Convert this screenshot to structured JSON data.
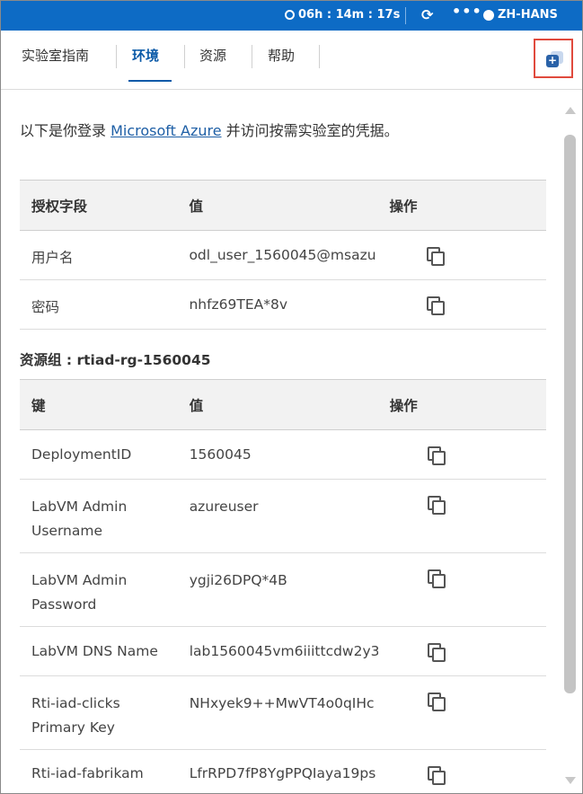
{
  "topbar": {
    "timer": "06h : 14m : 17s",
    "refresh_icon": "refresh-icon",
    "more_label": "•••",
    "language": "ZH-HANS"
  },
  "tabs": [
    {
      "label": "实验室指南",
      "active": false
    },
    {
      "label": "环境",
      "active": true
    },
    {
      "label": "资源",
      "active": false
    },
    {
      "label": "帮助",
      "active": false
    }
  ],
  "intro": {
    "prefix": "以下是你登录 ",
    "link": "Microsoft Azure",
    "suffix": " 并访问按需实验室的凭据。"
  },
  "credentials_table": {
    "headers": [
      "授权字段",
      "值",
      "操作"
    ],
    "rows": [
      {
        "field": "用户名",
        "value": "odl_user_1560045@msazu"
      },
      {
        "field": "密码",
        "value": "nhfz69TEA*8v"
      }
    ]
  },
  "resource_group": {
    "label": "资源组 : rtiad-rg-1560045"
  },
  "resource_table": {
    "headers": [
      "键",
      "值",
      "操作"
    ],
    "rows": [
      {
        "key": "DeploymentID",
        "key2": "",
        "value": "1560045"
      },
      {
        "key": "LabVM Admin",
        "key2": "Username",
        "value": "azureuser"
      },
      {
        "key": "LabVM Admin",
        "key2": "Password",
        "value": "ygji26DPQ*4B"
      },
      {
        "key": "LabVM DNS Name",
        "key2": "",
        "value": "lab1560045vm6iiittcdw2y3"
      },
      {
        "key": "Rti-iad-clicks",
        "key2": "Primary Key",
        "value": "NHxyek9++MwVT4o0qIHc"
      },
      {
        "key": "Rti-iad-fabrikam",
        "key2": "",
        "value": "LfrRPD7fP8YgPPQIaya19ps"
      }
    ]
  },
  "colors": {
    "topbar": "#0d6bc5",
    "active_tab": "#0b5aa8",
    "highlight_box": "#e04a3d"
  }
}
